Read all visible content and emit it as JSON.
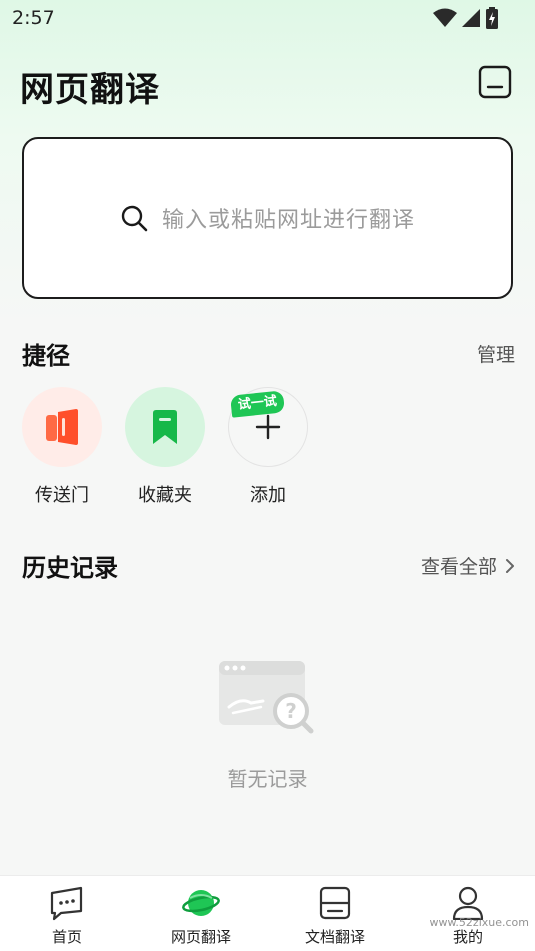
{
  "status_bar": {
    "time": "2:57"
  },
  "header": {
    "title": "网页翻译",
    "menu_icon": "minimize-box-icon"
  },
  "search": {
    "placeholder": "输入或粘贴网址进行翻译",
    "icon": "search-icon"
  },
  "shortcuts": {
    "title": "捷径",
    "manage": "管理",
    "items": [
      {
        "label": "传送门",
        "icon": "portal-icon",
        "bg": "#ffece8",
        "fg": "#ff5a36"
      },
      {
        "label": "收藏夹",
        "icon": "bookmark-icon",
        "bg": "#d6f5df",
        "fg": "#14b848"
      },
      {
        "label": "添加",
        "icon": "plus-icon",
        "badge": "试一试"
      }
    ]
  },
  "history": {
    "title": "历史记录",
    "view_all": "查看全部",
    "empty_text": "暂无记录"
  },
  "bottom_nav": {
    "items": [
      {
        "label": "首页",
        "icon": "chat-icon"
      },
      {
        "label": "网页翻译",
        "icon": "planet-icon"
      },
      {
        "label": "文档翻译",
        "icon": "document-icon"
      },
      {
        "label": "我的",
        "icon": "user-icon"
      }
    ],
    "watermark": "www.52zixue.com"
  },
  "colors": {
    "accent": "#1fc655",
    "text": "#111111",
    "muted": "#9b9b9b"
  }
}
